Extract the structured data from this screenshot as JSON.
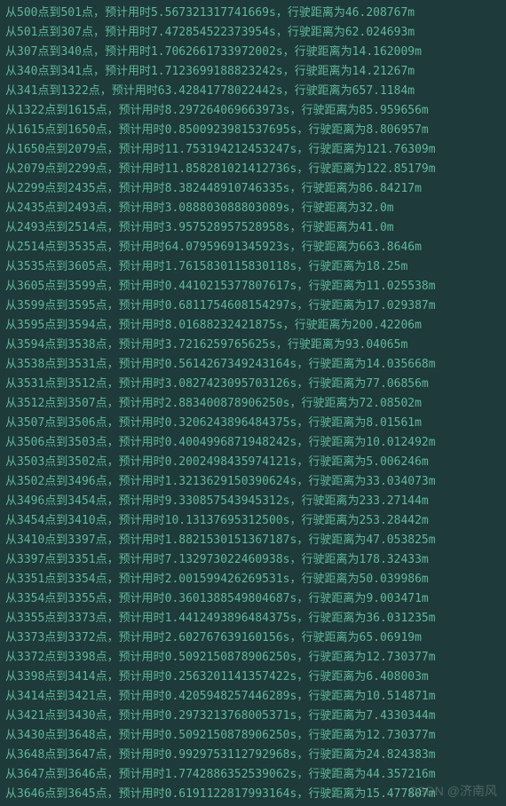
{
  "watermark": "CSDN @济南风",
  "labels": {
    "from": "从",
    "to": "点到",
    "point_suffix": "点，预计用时",
    "sec_suffix": "s，行驶距离为",
    "meter_suffix": "m"
  },
  "lines": [
    {
      "from": "500",
      "to": "501",
      "time": "5.567321317741669",
      "dist": "46.208767"
    },
    {
      "from": "501",
      "to": "307",
      "time": "7.472854522373954",
      "dist": "62.024693"
    },
    {
      "from": "307",
      "to": "340",
      "time": "1.7062661733972002",
      "dist": "14.162009"
    },
    {
      "from": "340",
      "to": "341",
      "time": "1.7123699188823242",
      "dist": "14.21267"
    },
    {
      "from": "341",
      "to": "1322",
      "time": "63.42841778022442",
      "dist": "657.1184"
    },
    {
      "from": "1322",
      "to": "1615",
      "time": "8.297264069663973",
      "dist": "85.959656"
    },
    {
      "from": "1615",
      "to": "1650",
      "time": "0.8500923981537695",
      "dist": "8.806957"
    },
    {
      "from": "1650",
      "to": "2079",
      "time": "11.753194212453247",
      "dist": "121.76309"
    },
    {
      "from": "2079",
      "to": "2299",
      "time": "11.858281021412736",
      "dist": "122.85179"
    },
    {
      "from": "2299",
      "to": "2435",
      "time": "8.382448910746335",
      "dist": "86.84217"
    },
    {
      "from": "2435",
      "to": "2493",
      "time": "3.088803088803089",
      "dist": "32.0"
    },
    {
      "from": "2493",
      "to": "2514",
      "time": "3.957528957528958",
      "dist": "41.0"
    },
    {
      "from": "2514",
      "to": "3535",
      "time": "64.07959691345923",
      "dist": "663.8646"
    },
    {
      "from": "3535",
      "to": "3605",
      "time": "1.7615830115830118",
      "dist": "18.25"
    },
    {
      "from": "3605",
      "to": "3599",
      "time": "0.4410215377807617",
      "dist": "11.025538"
    },
    {
      "from": "3599",
      "to": "3595",
      "time": "0.6811754608154297",
      "dist": "17.029387"
    },
    {
      "from": "3595",
      "to": "3594",
      "time": "8.01688232421875",
      "dist": "200.42206"
    },
    {
      "from": "3594",
      "to": "3538",
      "time": "3.7216259765625",
      "dist": "93.04065"
    },
    {
      "from": "3538",
      "to": "3531",
      "time": "0.5614267349243164",
      "dist": "14.035668"
    },
    {
      "from": "3531",
      "to": "3512",
      "time": "3.0827423095703126",
      "dist": "77.06856"
    },
    {
      "from": "3512",
      "to": "3507",
      "time": "2.883400878906250",
      "dist": "72.08502"
    },
    {
      "from": "3507",
      "to": "3506",
      "time": "0.3206243896484375",
      "dist": "8.01561"
    },
    {
      "from": "3506",
      "to": "3503",
      "time": "0.4004996871948242",
      "dist": "10.012492"
    },
    {
      "from": "3503",
      "to": "3502",
      "time": "0.2002498435974121",
      "dist": "5.006246"
    },
    {
      "from": "3502",
      "to": "3496",
      "time": "1.3213629150390624",
      "dist": "33.034073"
    },
    {
      "from": "3496",
      "to": "3454",
      "time": "9.330857543945312",
      "dist": "233.27144"
    },
    {
      "from": "3454",
      "to": "3410",
      "time": "10.13137695312500",
      "dist": "253.28442"
    },
    {
      "from": "3410",
      "to": "3397",
      "time": "1.8821530151367187",
      "dist": "47.053825"
    },
    {
      "from": "3397",
      "to": "3351",
      "time": "7.132973022460938",
      "dist": "178.32433"
    },
    {
      "from": "3351",
      "to": "3354",
      "time": "2.001599426269531",
      "dist": "50.039986"
    },
    {
      "from": "3354",
      "to": "3355",
      "time": "0.3601388549804687",
      "dist": "9.003471"
    },
    {
      "from": "3355",
      "to": "3373",
      "time": "1.4412493896484375",
      "dist": "36.031235"
    },
    {
      "from": "3373",
      "to": "3372",
      "time": "2.602767639160156",
      "dist": "65.06919"
    },
    {
      "from": "3372",
      "to": "3398",
      "time": "0.5092150878906250",
      "dist": "12.730377"
    },
    {
      "from": "3398",
      "to": "3414",
      "time": "0.2563201141357422",
      "dist": "6.408003"
    },
    {
      "from": "3414",
      "to": "3421",
      "time": "0.4205948257446289",
      "dist": "10.514871"
    },
    {
      "from": "3421",
      "to": "3430",
      "time": "0.2973213768005371",
      "dist": "7.4330344"
    },
    {
      "from": "3430",
      "to": "3648",
      "time": "0.5092150878906250",
      "dist": "12.730377"
    },
    {
      "from": "3648",
      "to": "3647",
      "time": "0.9929753112792968",
      "dist": "24.824383"
    },
    {
      "from": "3647",
      "to": "3646",
      "time": "1.7742886352539062",
      "dist": "44.357216"
    },
    {
      "from": "3646",
      "to": "3645",
      "time": "0.6191122817993164",
      "dist": "15.477807"
    }
  ]
}
